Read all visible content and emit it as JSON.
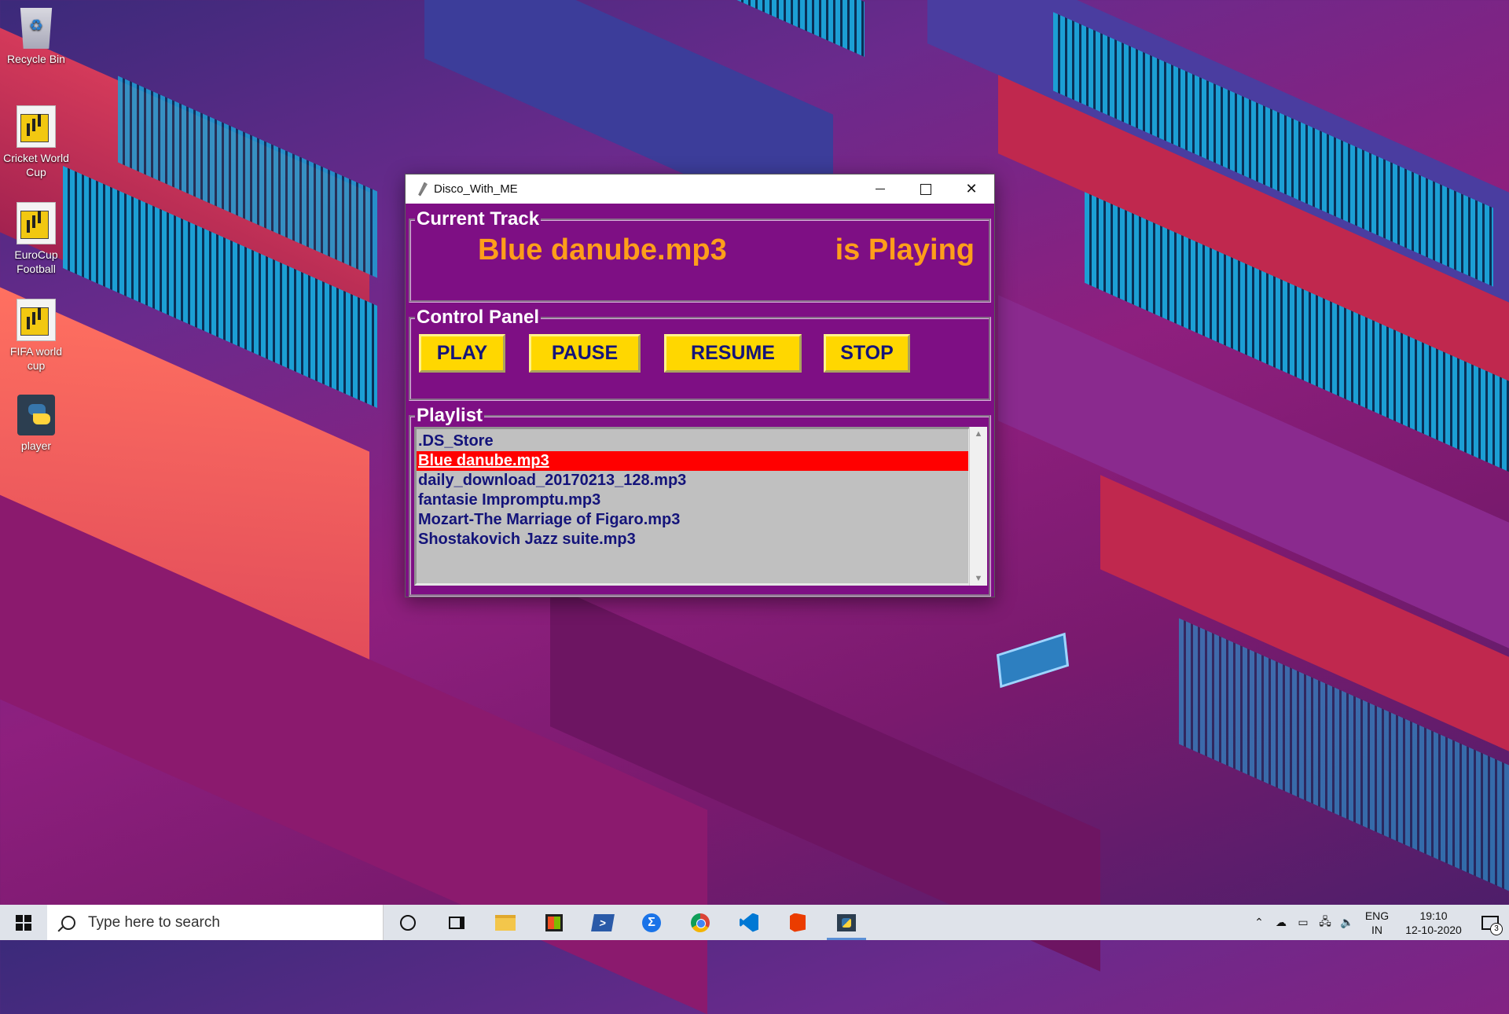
{
  "desktop": {
    "icons": [
      {
        "label": "Recycle Bin",
        "icon": "recycle-bin-icon"
      },
      {
        "label": "Cricket World Cup",
        "icon": "power-bi-icon"
      },
      {
        "label": "EuroCup Football",
        "icon": "power-bi-icon"
      },
      {
        "label": "FIFA world cup",
        "icon": "power-bi-icon"
      },
      {
        "label": "player",
        "icon": "python-file-icon"
      }
    ]
  },
  "window": {
    "title": "Disco_With_ME",
    "controls": {
      "minimize": "minimize-icon",
      "maximize": "maximize-icon",
      "close": "close-icon"
    }
  },
  "current_track": {
    "label": "Current Track",
    "track_name": "Blue danube.mp3",
    "status": "is Playing"
  },
  "control_panel": {
    "label": "Control Panel",
    "buttons": {
      "play": "PLAY",
      "pause": "PAUSE",
      "resume": "RESUME",
      "stop": "STOP"
    }
  },
  "playlist": {
    "label": "Playlist",
    "items": [
      ".DS_Store",
      "Blue danube.mp3",
      "daily_download_20170213_128.mp3",
      "fantasie Impromptu.mp3",
      "Mozart-The Marriage of Figaro.mp3",
      "Shostakovich Jazz suite.mp3"
    ],
    "selected_index": 1
  },
  "colors": {
    "window_bg": "#7e0f84",
    "track_text": "#ff9e1a",
    "button_bg": "#ffd700",
    "button_text": "#14147a",
    "selection_bg": "#ff0000"
  },
  "taskbar": {
    "search_placeholder": "Type here to search",
    "apps": [
      "cortana-icon",
      "task-view-icon",
      "file-explorer-icon",
      "store-icon",
      "powershell-icon",
      "sigma-app-icon",
      "chrome-icon",
      "vscode-icon",
      "office-icon",
      "python-app-icon"
    ],
    "language_line1": "ENG",
    "language_line2": "IN",
    "time": "19:10",
    "date": "12-10-2020",
    "notification_count": "3"
  }
}
